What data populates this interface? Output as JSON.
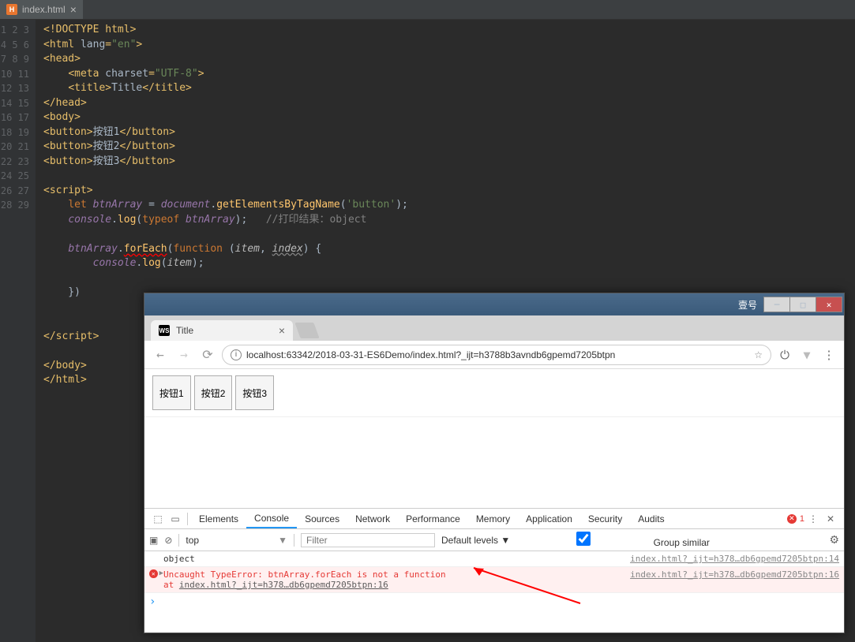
{
  "ide": {
    "tab_filename": "index.html",
    "lines": 29
  },
  "code": {
    "l1": {
      "doctype": "!DOCTYPE html"
    },
    "l2": {
      "tag": "html",
      "attr": "lang",
      "val": "\"en\""
    },
    "l3": {
      "tag": "head"
    },
    "l4": {
      "tag": "meta",
      "attr": "charset",
      "val": "\"UTF-8\""
    },
    "l5": {
      "open": "title",
      "text": "Title",
      "close": "title"
    },
    "l6": {
      "close": "head"
    },
    "l7": {
      "tag": "body"
    },
    "l8": {
      "open": "button",
      "text": "按钮1",
      "close": "button"
    },
    "l9": {
      "open": "button",
      "text": "按钮2",
      "close": "button"
    },
    "l10": {
      "open": "button",
      "text": "按钮3",
      "close": "button"
    },
    "l12": {
      "tag": "script"
    },
    "l13": {
      "let": "let",
      "var": "btnArray",
      "eq": " = ",
      "doc": "document",
      "dot": ".",
      "fn": "getElementsByTagName",
      "arg": "'button'"
    },
    "l14": {
      "console": "console",
      "log": "log",
      "typeof": "typeof",
      "arg": "btnArray",
      "comment": "//打印结果：object"
    },
    "l16": {
      "obj": "btnArray",
      "method": "forEach",
      "kw": "function",
      "a1": "item",
      "a2": "index"
    },
    "l17": {
      "console": "console",
      "log": "log",
      "arg": "item"
    },
    "l22": {
      "close": "script"
    },
    "l24": {
      "close": "body"
    },
    "l25": {
      "close": "html"
    }
  },
  "browser": {
    "win_title": "壹号",
    "tab_title": "Title",
    "url": "localhost:63342/2018-03-31-ES6Demo/index.html?_ijt=h3788b3avndb6gpemd7205btpn",
    "buttons": [
      "按钮1",
      "按钮2",
      "按钮3"
    ]
  },
  "devtools": {
    "tabs": [
      "Elements",
      "Console",
      "Sources",
      "Network",
      "Performance",
      "Memory",
      "Application",
      "Security",
      "Audits"
    ],
    "active_tab": "Console",
    "error_count": "1",
    "ctx": "top",
    "filter_placeholder": "Filter",
    "levels": "Default levels ▼",
    "group": "Group similar",
    "log1": {
      "text": "object",
      "src": "index.html?_ijt=h378…db6gpemd7205btpn:14"
    },
    "log2": {
      "text": "Uncaught TypeError: btnArray.forEach is not a function",
      "at": "    at ",
      "loc": "index.html?_ijt=h378…db6gpemd7205btpn:16",
      "src": "index.html?_ijt=h378…db6gpemd7205btpn:16"
    }
  }
}
